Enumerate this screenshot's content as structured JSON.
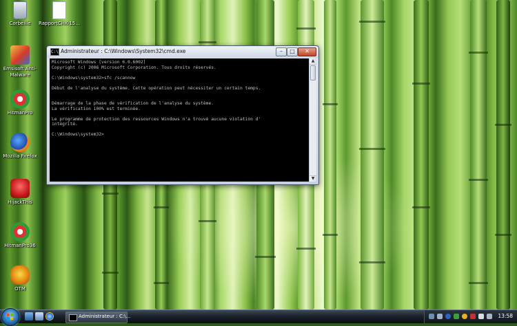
{
  "desktop": {
    "icons": [
      {
        "label": "Corbeille",
        "icon": "recycle-bin-icon"
      },
      {
        "label": "RapportCHK-15...",
        "icon": "document-icon"
      },
      {
        "label": "Emsisoft Anti-Malware",
        "icon": "emsisoft-icon"
      },
      {
        "label": "HitmanPro",
        "icon": "hitmanpro-icon"
      },
      {
        "label": "Mozilla Firefox",
        "icon": "firefox-icon"
      },
      {
        "label": "HijackThis",
        "icon": "hijackthis-icon"
      },
      {
        "label": "HitmanPro36",
        "icon": "hitmanpro-icon"
      },
      {
        "label": "OTM",
        "icon": "otm-icon"
      }
    ]
  },
  "cmd_window": {
    "title": "Administrateur : C:\\Windows\\System32\\cmd.exe",
    "min_glyph": "–",
    "max_glyph": "□",
    "close_glyph": "✕",
    "lines": [
      "Microsoft Windows [version 6.0.6002]",
      "Copyright (c) 2006 Microsoft Corporation. Tous droits réservés.",
      "",
      "C:\\Windows\\system32>sfc /scannow",
      "",
      "Début de l'analyse du système. Cette opération peut nécessiter un certain temps.",
      "",
      "",
      "Démarrage de la phase de vérification de l'analyse du système.",
      "La vérification 100% est terminée.",
      "",
      "Le programme de protection des ressources Windows n'a trouvé aucune violation d'",
      "intégrité.",
      "",
      "C:\\Windows\\system32>"
    ]
  },
  "taskbar": {
    "quick_launch": [
      "show-desktop-icon",
      "switch-windows-icon",
      "internet-explorer-icon"
    ],
    "task_button_label": "Administrateur : C:\\...",
    "tray_icons": [
      "network-icon",
      "volume-icon",
      "bluetooth-icon",
      "antivirus-icon",
      "update-icon",
      "security-icon",
      "language-icon",
      "speaker-icon"
    ],
    "clock": "13:58"
  },
  "colors": {
    "console_bg": "#000000",
    "console_text": "#c0c0c0",
    "taskbar": "#1b222b",
    "accent_close": "#c0452c"
  }
}
